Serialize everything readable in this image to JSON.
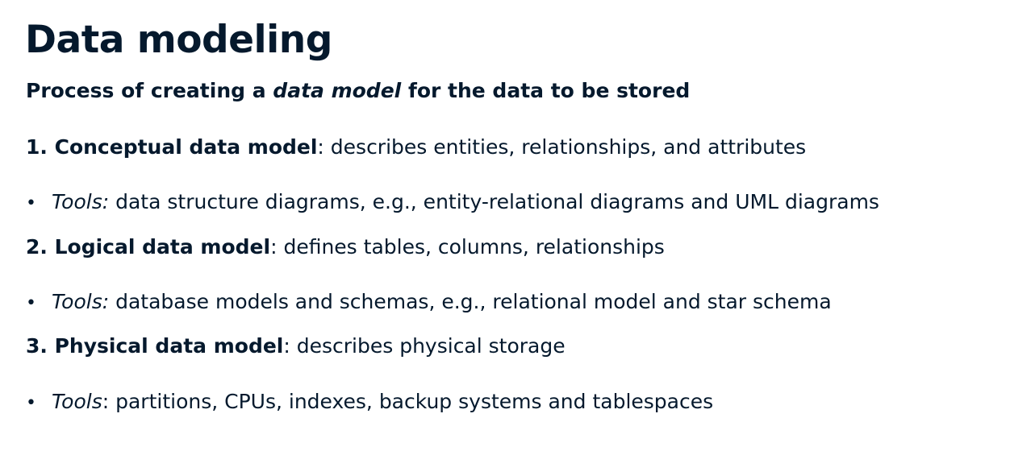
{
  "title": "Data modeling",
  "subtitle": {
    "before": "Process of creating a ",
    "emphasis": "data model",
    "after": " for the data to be stored"
  },
  "items": [
    {
      "heading": "1. Conceptual data model",
      "description": ": describes entities, relationships, and attributes",
      "bullet": "•",
      "tools_label": "Tools:",
      "tools_text": " data structure diagrams, e.g., entity-relational diagrams and UML diagrams"
    },
    {
      "heading": "2. Logical data model",
      "description": ": defines tables, columns, relationships",
      "bullet": "•",
      "tools_label": "Tools:",
      "tools_text": " database models and schemas, e.g., relational model and star schema"
    },
    {
      "heading": "3. Physical data model",
      "description": ": describes physical storage",
      "bullet": "•",
      "tools_label": "Tools",
      "tools_text": ": partitions, CPUs, indexes, backup systems and tablespaces"
    }
  ]
}
